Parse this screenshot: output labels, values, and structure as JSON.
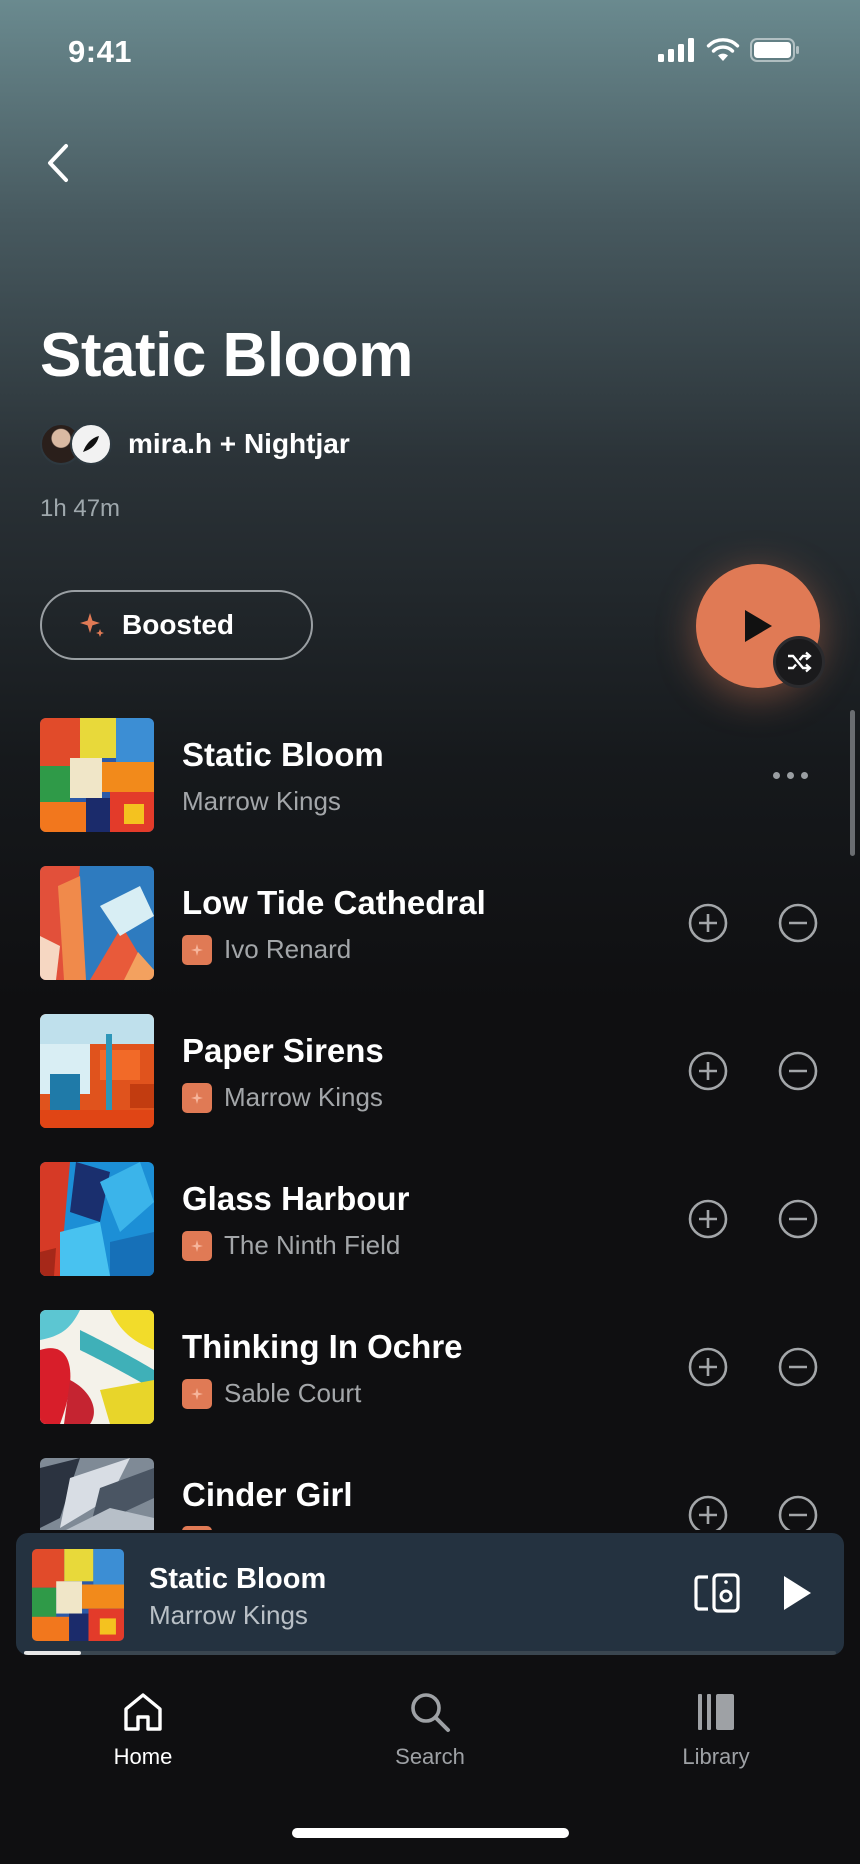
{
  "status_bar": {
    "time": "9:41"
  },
  "playlist": {
    "title": "Static Bloom",
    "owners": "mira.h + Nightjar",
    "duration": "1h 47m",
    "boosted_label": "Boosted"
  },
  "tracks": [
    {
      "title": "Static Bloom",
      "artist": "Marrow Kings",
      "boosted": false
    },
    {
      "title": "Low Tide Cathedral",
      "artist": "Ivo Renard",
      "boosted": true
    },
    {
      "title": "Paper Sirens",
      "artist": "Marrow Kings",
      "boosted": true
    },
    {
      "title": "Glass Harbour",
      "artist": "The Ninth Field",
      "boosted": true
    },
    {
      "title": "Thinking In Ochre",
      "artist": "Sable Court",
      "boosted": true
    },
    {
      "title": "Cinder Girl",
      "artist": "",
      "boosted": true
    }
  ],
  "now_playing": {
    "title": "Static Bloom",
    "artist": "Marrow Kings",
    "progress": 0.07
  },
  "tab_bar": {
    "home": "Home",
    "search": "Search",
    "library": "Library",
    "active": "home"
  },
  "colors": {
    "accent": "#e07a55",
    "background": "#0f0f11",
    "mini_player": "#243240"
  }
}
